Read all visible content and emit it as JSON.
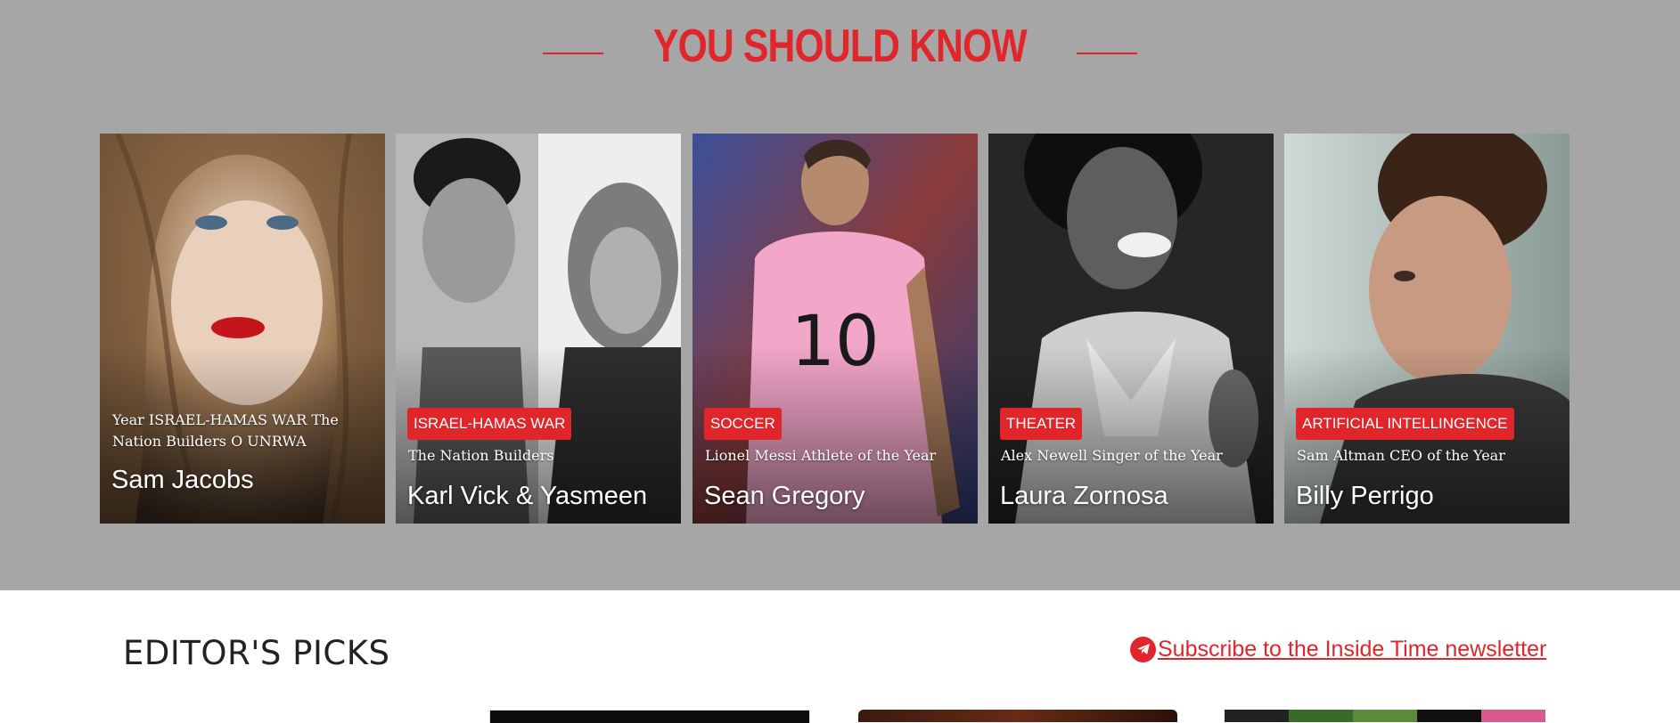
{
  "section": {
    "title": "YOU SHOULD KNOW"
  },
  "cards": [
    {
      "tag": "",
      "subtitle": "Year ISRAEL-HAMAS WAR The Nation Builders O UNRWA",
      "author": "Sam Jacobs"
    },
    {
      "tag": "ISRAEL-HAMAS WAR",
      "subtitle": "The Nation Builders",
      "author": "Karl Vick & Yasmeen"
    },
    {
      "tag": "SOCCER",
      "subtitle": "Lionel Messi Athlete of the Year",
      "author": "Sean Gregory"
    },
    {
      "tag": "THEATER",
      "subtitle": "Alex Newell Singer of the Year",
      "author": "Laura Zornosa"
    },
    {
      "tag": "ARTIFICIAL INTELLINGENCE",
      "subtitle": "Sam Altman CEO of the Year",
      "author": "Billy Perrigo"
    }
  ],
  "editors_picks": {
    "title": "EDITOR'S PICKS",
    "subscribe_label": "Subscribe to the Inside Time newsletter",
    "subscribe_icon": "telegram-icon"
  },
  "colors": {
    "accent": "#e0252b",
    "section_bg": "#a6a6a6"
  }
}
